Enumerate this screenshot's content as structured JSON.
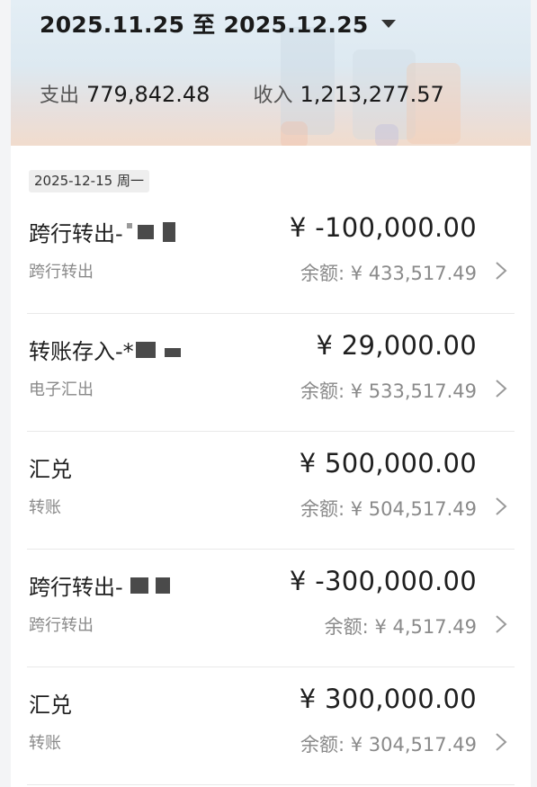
{
  "header": {
    "date_range": "2025.11.25 至 2025.12.25",
    "expense_label": "支出",
    "expense_value": "779,842.48",
    "income_label": "收入",
    "income_value": "1,213,277.57"
  },
  "date_group": {
    "date": "2025-12-15 周一"
  },
  "transactions": [
    {
      "title": "跨行转出-",
      "category": "跨行转出",
      "amount": "¥ -100,000.00",
      "balance_label": "余额:",
      "balance": "¥ 433,517.49"
    },
    {
      "title": "转账存入-*",
      "category": "电子汇出",
      "amount": "¥ 29,000.00",
      "balance_label": "余额:",
      "balance": "¥ 533,517.49"
    },
    {
      "title": "汇兑",
      "category": "转账",
      "amount": "¥ 500,000.00",
      "balance_label": "余额:",
      "balance": "¥ 504,517.49"
    },
    {
      "title": "跨行转出-",
      "category": "跨行转出",
      "amount": "¥ -300,000.00",
      "balance_label": "余额:",
      "balance": "¥ 4,517.49"
    },
    {
      "title": "汇兑",
      "category": "转账",
      "amount": "¥ 300,000.00",
      "balance_label": "余额:",
      "balance": "¥ 304,517.49"
    }
  ]
}
